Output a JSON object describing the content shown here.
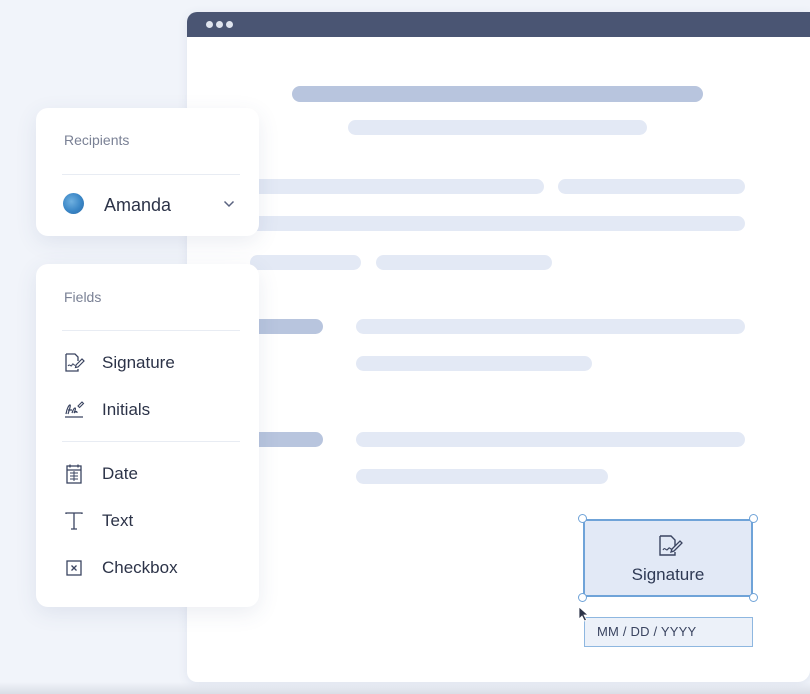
{
  "recipients": {
    "heading": "Recipients",
    "selected": "Amanda",
    "avatar_color": "#3a86c6"
  },
  "fields": {
    "heading": "Fields",
    "items": [
      {
        "label": "Signature",
        "icon": "signature-icon"
      },
      {
        "label": "Initials",
        "icon": "initials-icon"
      },
      {
        "label": "Date",
        "icon": "calendar-icon"
      },
      {
        "label": "Text",
        "icon": "text-icon"
      },
      {
        "label": "Checkbox",
        "icon": "checkbox-icon"
      }
    ]
  },
  "document": {
    "placed_signature_label": "Signature",
    "placed_date_placeholder": "MM / DD / YYYY"
  },
  "colors": {
    "accent": "#6fa3d8",
    "titlebar": "#4a5573",
    "background": "#f1f4fa"
  }
}
